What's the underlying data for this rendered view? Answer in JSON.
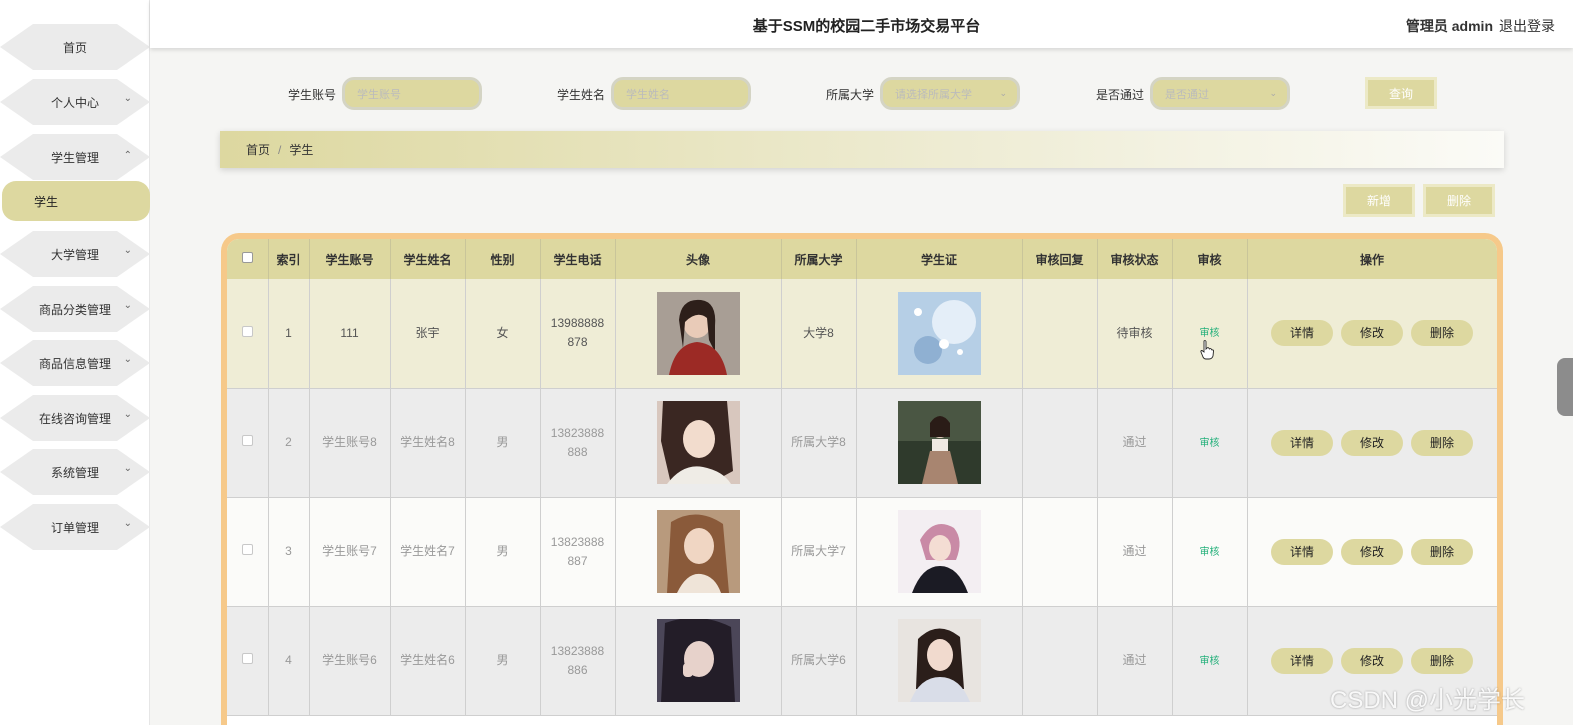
{
  "app": {
    "title": "基于SSM的校园二手市场交易平台",
    "admin_label": "管理员 admin",
    "logout_label": "退出登录"
  },
  "sidebar": {
    "items": [
      {
        "label": "首页",
        "expandable": false
      },
      {
        "label": "个人中心",
        "expandable": true,
        "expanded": false
      },
      {
        "label": "学生管理",
        "expandable": true,
        "expanded": true
      },
      {
        "label": "大学管理",
        "expandable": true,
        "expanded": false
      },
      {
        "label": "商品分类管理",
        "expandable": true,
        "expanded": false
      },
      {
        "label": "商品信息管理",
        "expandable": true,
        "expanded": false
      },
      {
        "label": "在线咨询管理",
        "expandable": true,
        "expanded": false
      },
      {
        "label": "系统管理",
        "expandable": true,
        "expanded": false
      },
      {
        "label": "订单管理",
        "expandable": true,
        "expanded": false
      }
    ],
    "active_sub": "学生"
  },
  "search": {
    "account_label": "学生账号",
    "account_placeholder": "学生账号",
    "name_label": "学生姓名",
    "name_placeholder": "学生姓名",
    "university_label": "所属大学",
    "university_placeholder": "请选择所属大学",
    "passed_label": "是否通过",
    "passed_placeholder": "是否通过",
    "query_button": "查询"
  },
  "breadcrumb": {
    "home": "首页",
    "separator": "/",
    "current": "学生"
  },
  "actions": {
    "add": "新增",
    "delete": "删除"
  },
  "table": {
    "columns": [
      "索引",
      "学生账号",
      "学生姓名",
      "性别",
      "学生电话",
      "头像",
      "所属大学",
      "学生证",
      "审核回复",
      "审核状态",
      "审核",
      "操作"
    ],
    "audit_link": "审核",
    "row_buttons": {
      "detail": "详情",
      "edit": "修改",
      "delete": "删除"
    },
    "rows": [
      {
        "index": "1",
        "account": "111",
        "name": "张宇",
        "gender": "女",
        "phone_line1": "13988888",
        "phone_line2": "878",
        "university": "大学8",
        "reply": "",
        "status": "待审核"
      },
      {
        "index": "2",
        "account": "学生账号8",
        "name": "学生姓名8",
        "gender": "男",
        "phone_line1": "13823888",
        "phone_line2": "888",
        "university": "所属大学8",
        "reply": "",
        "status": "通过"
      },
      {
        "index": "3",
        "account": "学生账号7",
        "name": "学生姓名7",
        "gender": "男",
        "phone_line1": "13823888",
        "phone_line2": "887",
        "university": "所属大学7",
        "reply": "",
        "status": "通过"
      },
      {
        "index": "4",
        "account": "学生账号6",
        "name": "学生姓名6",
        "gender": "男",
        "phone_line1": "13823888",
        "phone_line2": "886",
        "university": "所属大学6",
        "reply": "",
        "status": "通过"
      }
    ]
  },
  "watermark": "CSDN @小光学长",
  "colors": {
    "accent": "#ddd8a0",
    "table_border": "#f6c98a",
    "audit_link": "#23b07a"
  }
}
